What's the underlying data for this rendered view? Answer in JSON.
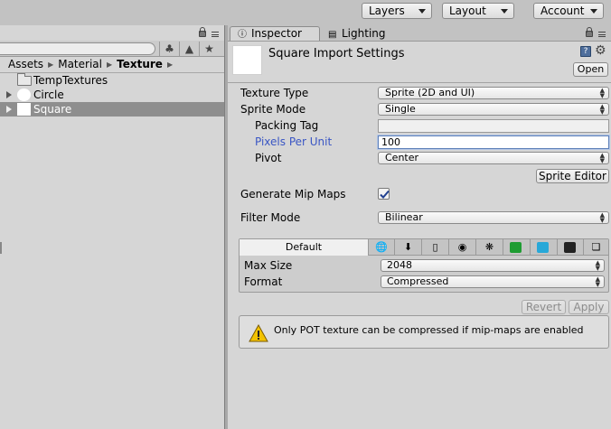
{
  "toolbar": {
    "layers_label": "Layers",
    "layout_label": "Layout",
    "account_label": "Account"
  },
  "project": {
    "breadcrumb": [
      "Assets",
      "Material",
      "Texture"
    ],
    "tree": [
      {
        "label": "TempTextures",
        "kind": "folder"
      },
      {
        "label": "Circle",
        "kind": "sprite-circle"
      },
      {
        "label": "Square",
        "kind": "sprite-square",
        "selected": true
      }
    ]
  },
  "inspector": {
    "tabs": [
      {
        "label": "Inspector",
        "icon": "info-icon",
        "active": true
      },
      {
        "label": "Lighting",
        "icon": "lighting-icon",
        "active": false
      }
    ],
    "header_title": "Square Import Settings",
    "open_label": "Open",
    "texture_type_label": "Texture Type",
    "texture_type_value": "Sprite (2D and UI)",
    "sprite_mode_label": "Sprite Mode",
    "sprite_mode_value": "Single",
    "packing_tag_label": "Packing Tag",
    "packing_tag_value": "",
    "pixels_per_unit_label": "Pixels Per Unit",
    "pixels_per_unit_value": "100",
    "pivot_label": "Pivot",
    "pivot_value": "Center",
    "sprite_editor_label": "Sprite Editor",
    "generate_mip_maps_label": "Generate Mip Maps",
    "generate_mip_maps_checked": true,
    "filter_mode_label": "Filter Mode",
    "filter_mode_value": "Bilinear",
    "platform_tabs": {
      "default_label": "Default",
      "icons": [
        "web-globe-icon",
        "download-icon",
        "iphone-icon",
        "android-icon",
        "blackberry-icon",
        "windows-store-icon",
        "windows-phone-icon",
        "html5-icon",
        "unity-box-icon"
      ]
    },
    "max_size_label": "Max Size",
    "max_size_value": "2048",
    "format_label": "Format",
    "format_value": "Compressed",
    "revert_label": "Revert",
    "apply_label": "Apply",
    "warning_text": "Only POT texture can be compressed if mip-maps are enabled"
  },
  "colors": {
    "highlight_label": "#3a56c4",
    "selected_row": "#8e8e8e",
    "warning_yellow": "#f2c200"
  }
}
